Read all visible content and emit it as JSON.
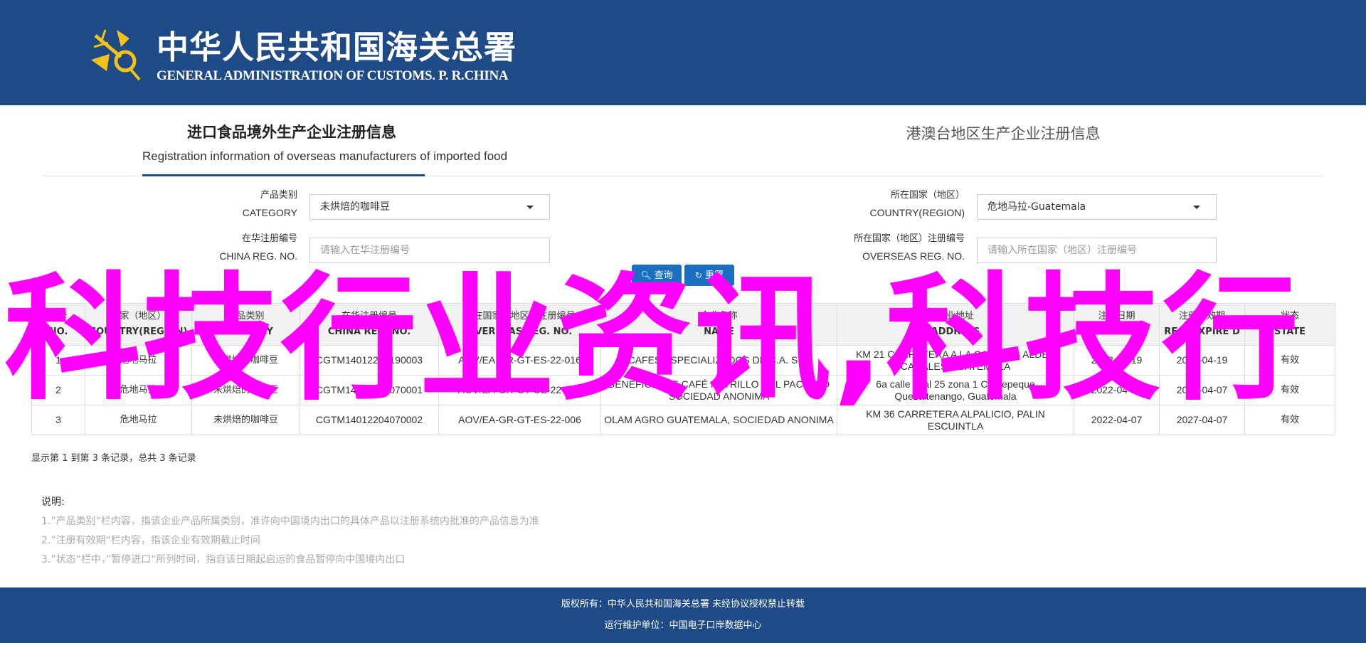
{
  "header": {
    "title_cn": "中华人民共和国海关总署",
    "title_en": "GENERAL ADMINISTRATION OF CUSTOMS. P. R.CHINA",
    "logo_icon": "customs-emblem-icon"
  },
  "tabs": [
    {
      "label_cn": "进口食品境外生产企业注册信息",
      "label_en": "Registration information of overseas manufacturers of imported food"
    },
    {
      "label_cn": "港澳台地区生产企业注册信息"
    }
  ],
  "form": {
    "category": {
      "label_cn": "产品类别",
      "label_en": "CATEGORY",
      "value": "未烘焙的咖啡豆"
    },
    "country": {
      "label_cn": "所在国家（地区）",
      "label_en": "COUNTRY(REGION)",
      "value": "危地马拉-Guatemala"
    },
    "china_reg": {
      "label_cn": "在华注册编号",
      "label_en": "CHINA REG. NO.",
      "placeholder": "请输入在华注册编号"
    },
    "overseas_reg": {
      "label_cn": "所在国家（地区）注册编号",
      "label_en": "OVERSEAS REG. NO.",
      "placeholder": "请输入所在国家（地区）注册编号"
    },
    "search_label": "查询",
    "reset_label": "重置"
  },
  "table": {
    "columns": [
      {
        "cn": "序号",
        "en": "NO."
      },
      {
        "cn": "国家（地区）",
        "en": "COUNTRY(REGION)"
      },
      {
        "cn": "产品类别",
        "en": "CATEGORY"
      },
      {
        "cn": "在华注册编号",
        "en": "CHINA REG. NO."
      },
      {
        "cn": "所在国家（地区）注册编号",
        "en": "OVERSEAS REG. NO."
      },
      {
        "cn": "企业名称",
        "en": "NAME"
      },
      {
        "cn": "企业地址",
        "en": "ADDRESS"
      },
      {
        "cn": "注册日期",
        "en": "REG. DATE"
      },
      {
        "cn": "注册有效期",
        "en": "REG. EXPIRE D"
      },
      {
        "cn": "状态",
        "en": "STATE"
      }
    ],
    "rows": [
      [
        "1",
        "危地马拉",
        "未烘焙的咖啡豆",
        "CGTM14012204190003",
        "AOV/EA-GR-GT-ES-22-016",
        "CAFES ESPECIALIZADOS DE C.A. S.A.",
        "KM 21 CARRETERA A LA CANALES ALDEA CANALES GUATEMALA",
        "2022-04-19",
        "2027-04-19",
        "有效"
      ],
      [
        "2",
        "危地马拉",
        "未烘焙的咖啡豆",
        "CGTM14012204070001",
        "AOV/EA-GR-GT-OZ-22-002",
        "BENEFICIO DE CAFÉ PETRILLO DEL PACIFICO SOCIEDAD ANONIMA",
        "6a calle final 25 zona 1 Coatepeque Quezaltenango, Guatemala",
        "2022-04-07",
        "2027-04-07",
        "有效"
      ],
      [
        "3",
        "危地马拉",
        "未烘焙的咖啡豆",
        "CGTM14012204070002",
        "AOV/EA-GR-GT-ES-22-006",
        "OLAM AGRO GUATEMALA, SOCIEDAD ANONIMA",
        "KM 36 CARRETERA ALPALICIO, PALIN ESCUINTLA",
        "2022-04-07",
        "2027-04-07",
        "有效"
      ]
    ]
  },
  "pager_text": "显示第 1 到第 3 条记录，总共 3 条记录",
  "notes": {
    "title": "说明:",
    "items": [
      "1.”产品类别“栏内容，指该企业产品所属类别，准许向中国境内出口的具体产品以注册系统内批准的产品信息为准",
      "2.”注册有效期“栏内容，指该企业有效期截止时间",
      "3.”状态“栏中，”暂停进口“所列时间，指自该日期起启运的食品暂停向中国境内出口"
    ]
  },
  "footer": {
    "copyright": "版权所有：中华人民共和国海关总署 未经协议授权禁止转载",
    "maintainer": "运行维护单位：中国电子口岸数据中心"
  },
  "overlay_text": "科技行业资讯,科技行",
  "colors": {
    "brand": "#1e4a86",
    "button": "#1a6fc2",
    "overlay": "#ff00ff"
  }
}
